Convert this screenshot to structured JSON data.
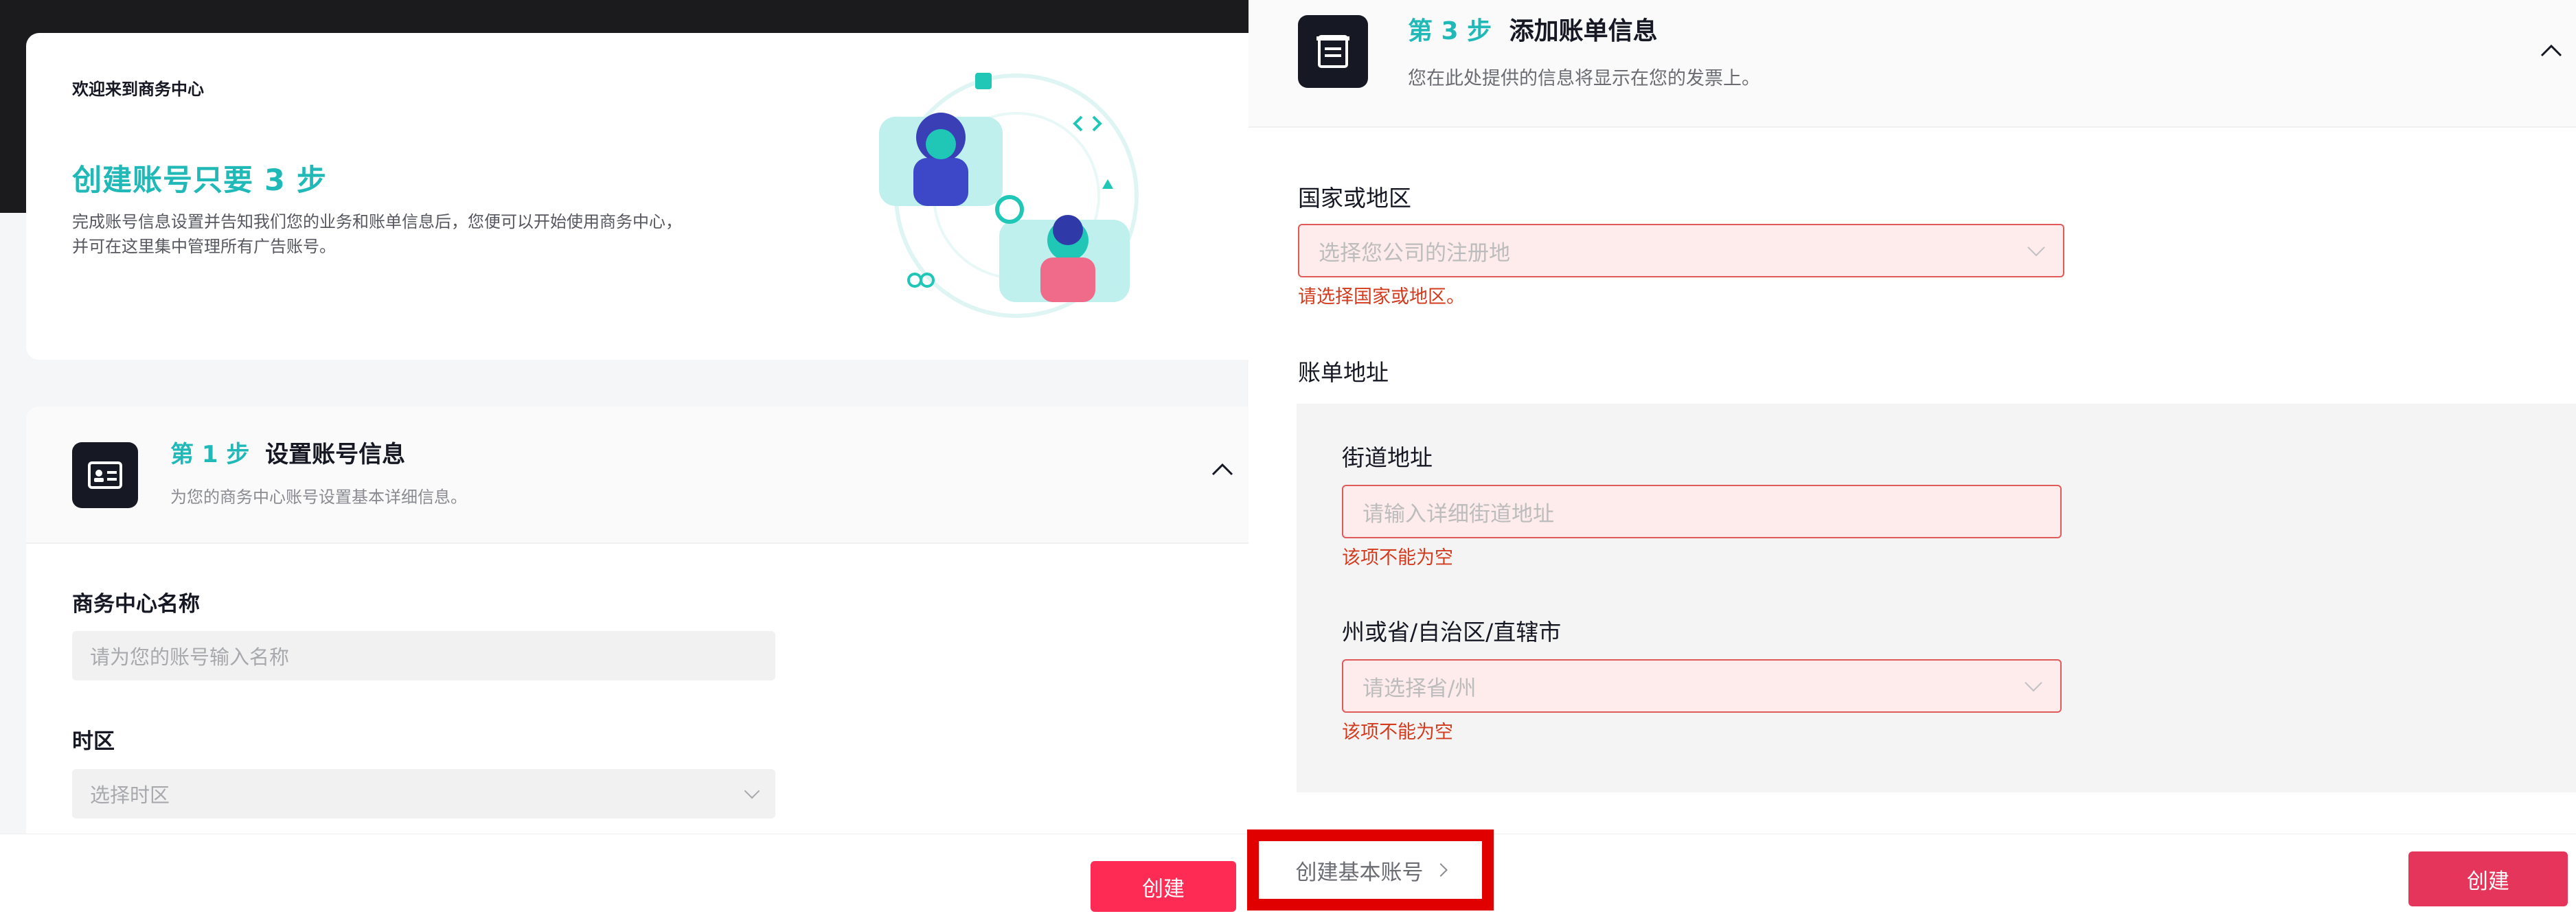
{
  "hero": {
    "welcome": "欢迎来到商务中心",
    "title": "创建账号只要 3 步",
    "desc_line1": "完成账号信息设置并告知我们您的业务和账单信息后，您便可以开始使用商务中心，",
    "desc_line2": "并可在这里集中管理所有广告账号。"
  },
  "step1": {
    "num": "第 1 步",
    "title": "设置账号信息",
    "sub": "为您的商务中心账号设置基本详细信息。",
    "name_label": "商务中心名称",
    "name_placeholder": "请为您的账号输入名称",
    "tz_label": "时区",
    "tz_placeholder": "选择时区"
  },
  "step3": {
    "num": "第 3 步",
    "title": "添加账单信息",
    "sub": "您在此处提供的信息将显示在您的发票上。",
    "country_label": "国家或地区",
    "country_placeholder": "选择您公司的注册地",
    "country_error": "请选择国家或地区。",
    "billing_label": "账单地址",
    "street_label": "街道地址",
    "street_placeholder": "请输入详细街道地址",
    "street_error": "该项不能为空",
    "state_label": "州或省/自治区/直辖市",
    "state_placeholder": "请选择省/州",
    "state_error": "该项不能为空"
  },
  "footer": {
    "create_left": "创建",
    "basic_account": "创建基本账号",
    "create_right": "创建"
  },
  "colors": {
    "accent": "#21b9b8",
    "primary_button": "#fe2c55",
    "error": "#d33b1f",
    "highlight_box": "#e10000"
  }
}
